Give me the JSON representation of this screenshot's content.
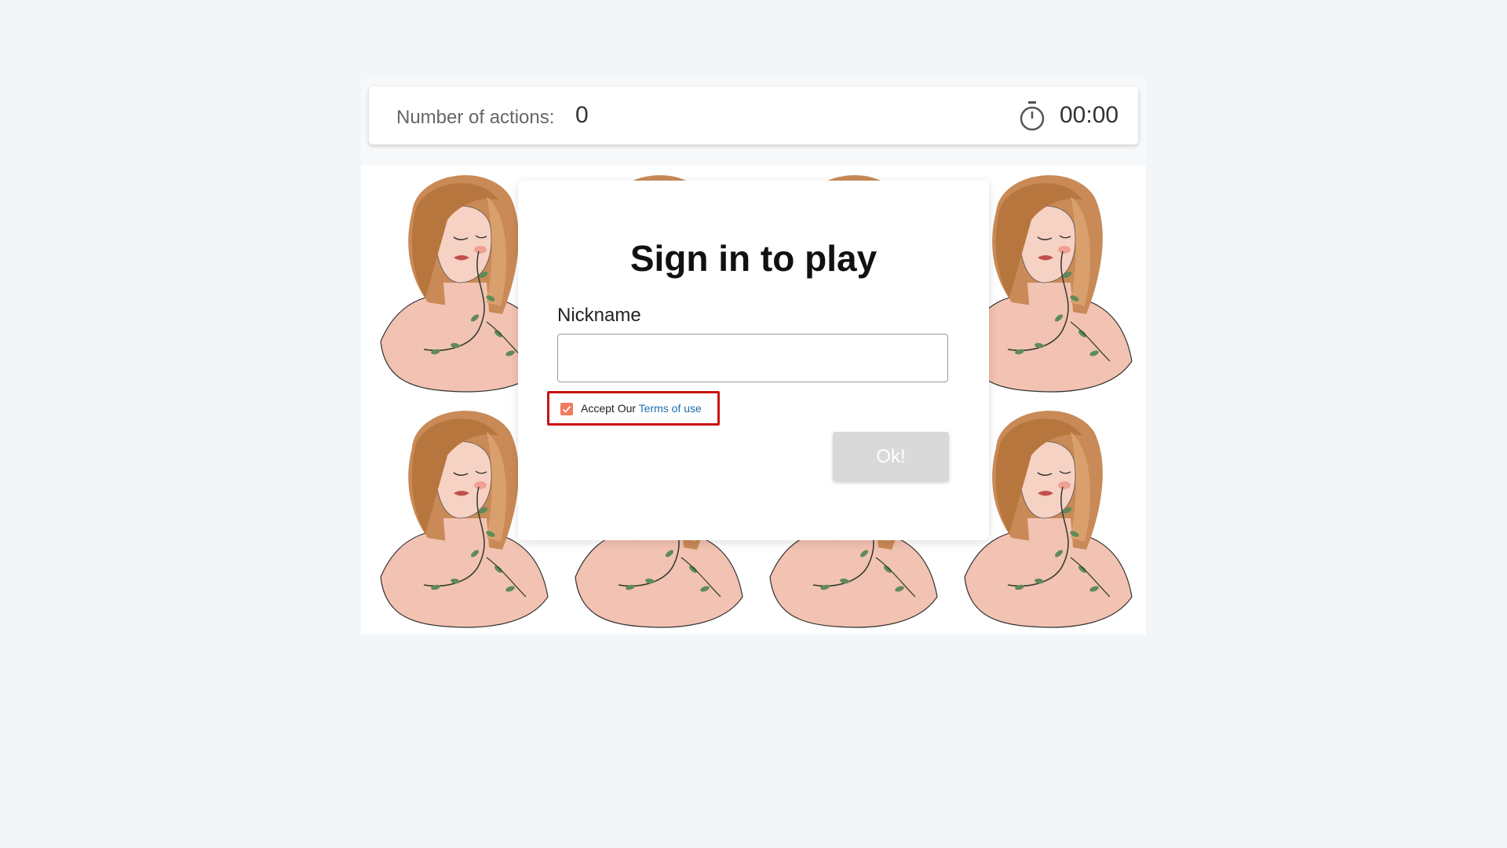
{
  "status_bar": {
    "actions_label": "Number of actions:",
    "actions_count": "0",
    "stopwatch_icon": "stopwatch-icon",
    "timer": "00:00"
  },
  "board": {
    "card_image": "woman-with-vines-portrait",
    "card_count": 8
  },
  "modal": {
    "title": "Sign in to play",
    "nickname_label": "Nickname",
    "nickname_value": "",
    "accept_prefix": "Accept Our ",
    "terms_link": "Terms of use",
    "terms_checked": true,
    "ok_label": "Ok!"
  },
  "colors": {
    "page_background": "#f3f6f9",
    "checkbox_accent": "#f27a5e",
    "highlight_border": "#cc1111",
    "link": "#1a6fb0",
    "disabled_button": "#d9d9d9"
  }
}
